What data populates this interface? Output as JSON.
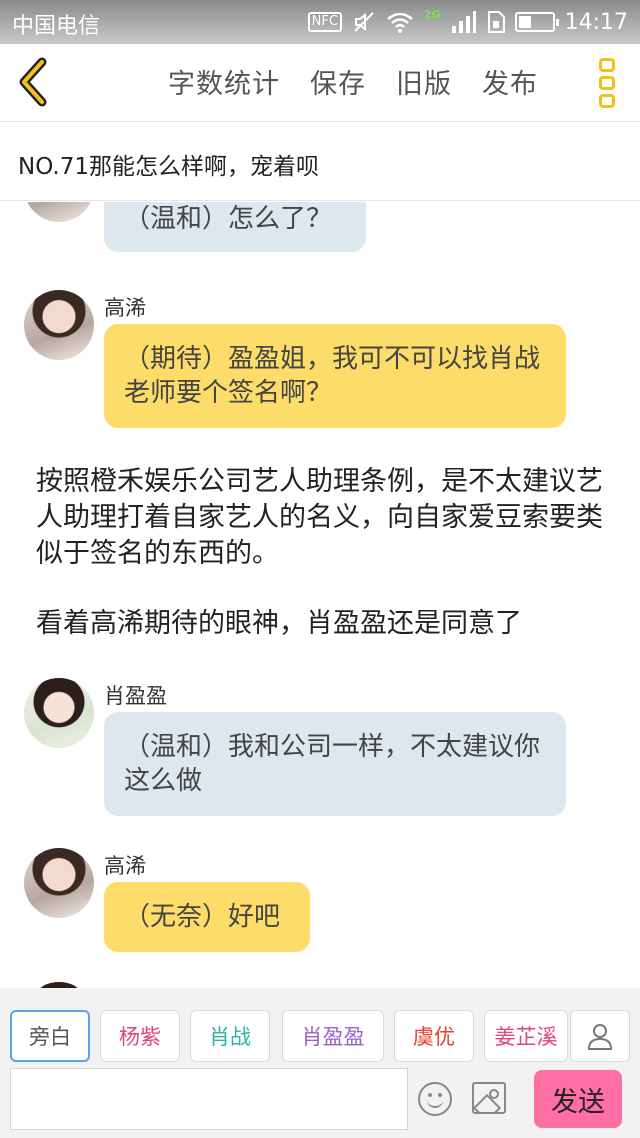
{
  "status_bar": {
    "carrier": "中国电信",
    "nfc": "NFC",
    "network": "2G",
    "time": "14:17",
    "battery_level": 0.35
  },
  "toolbar": {
    "word_count": "字数统计",
    "save": "保存",
    "old_version": "旧版",
    "publish": "发布"
  },
  "chapter": {
    "title": "NO.71那能怎么样啊，宠着呗"
  },
  "messages": [
    {
      "speaker": "",
      "text": "（温和）怎么了？",
      "color": "blue"
    },
    {
      "speaker": "高浠",
      "text": "（期待）盈盈姐，我可不可以找肖战老师要个签名啊？",
      "color": "yellow"
    },
    {
      "narration": "按照橙禾娱乐公司艺人助理条例，是不太建议艺人助理打着自家艺人的名义，向自家爱豆索要类似于签名的东西的。"
    },
    {
      "narration": "看着高浠期待的眼神，肖盈盈还是同意了"
    },
    {
      "speaker": "肖盈盈",
      "text": "（温和）我和公司一样，不太建议你这么做",
      "color": "blue"
    },
    {
      "speaker": "高浠",
      "text": "（无奈）好吧",
      "color": "yellow"
    }
  ],
  "roles": [
    {
      "label": "旁白",
      "color": "#555555",
      "active": true
    },
    {
      "label": "杨紫",
      "color": "#e0457b"
    },
    {
      "label": "肖战",
      "color": "#2bb3a3"
    },
    {
      "label": "肖盈盈",
      "color": "#9a5fc8"
    },
    {
      "label": "虞优",
      "color": "#e0452f"
    },
    {
      "label": "姜芷溪",
      "color": "#e0457b"
    }
  ],
  "input": {
    "placeholder": "",
    "send": "发送"
  },
  "colors": {
    "accent_yellow": "#fddc6a",
    "bubble_blue": "#dde7ee",
    "send_pink": "#ff6fa3",
    "icon_yellow": "#f2c21b"
  }
}
